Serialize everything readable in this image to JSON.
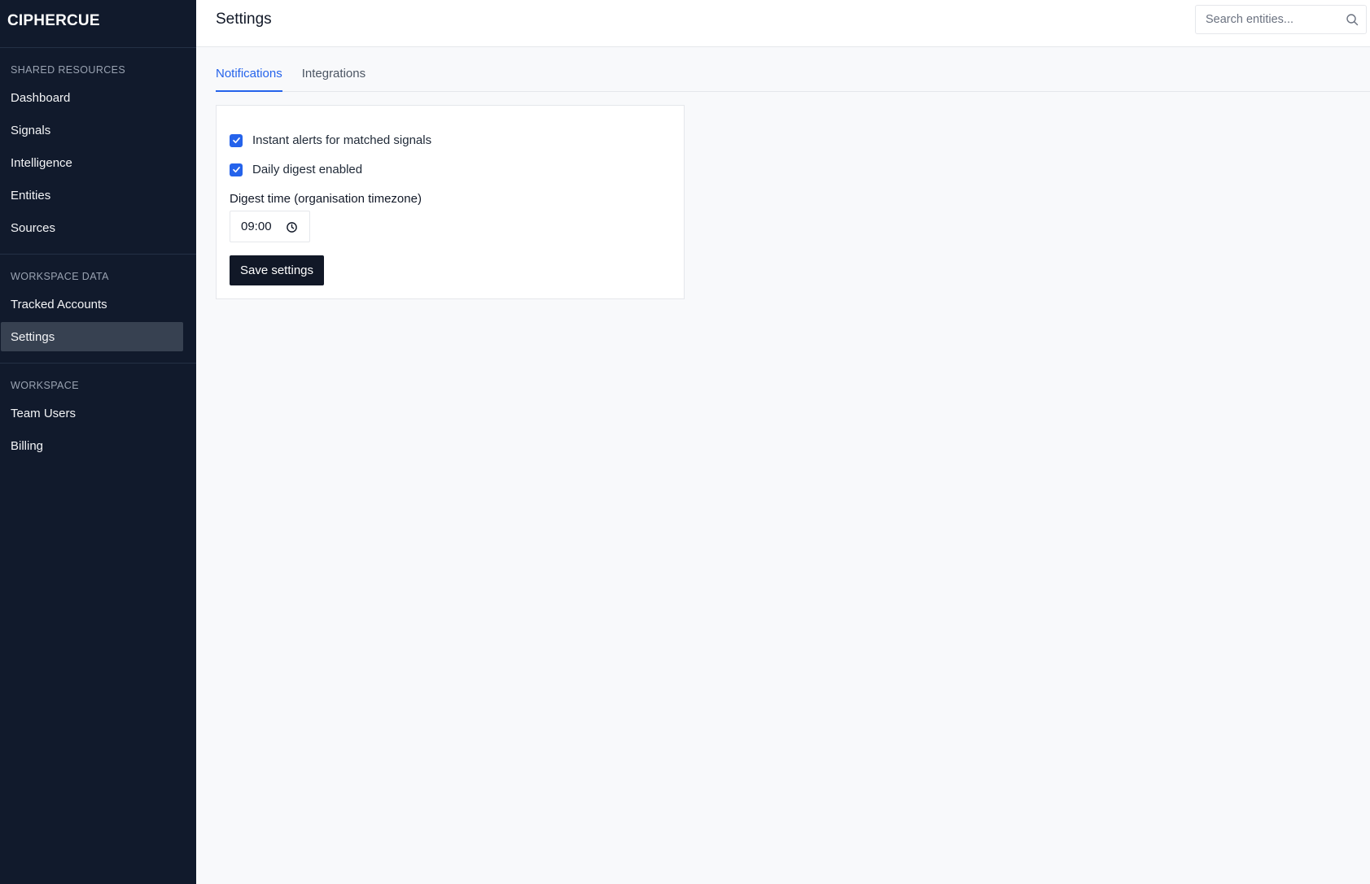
{
  "app": {
    "brand": "CIPHERCUE"
  },
  "sidebar": {
    "sections": [
      {
        "label": "SHARED RESOURCES",
        "items": [
          "Dashboard",
          "Signals",
          "Intelligence",
          "Entities",
          "Sources"
        ]
      },
      {
        "label": "WORKSPACE DATA",
        "items": [
          "Tracked Accounts",
          "Settings"
        ]
      },
      {
        "label": "WORKSPACE",
        "items": [
          "Team Users",
          "Billing"
        ]
      }
    ],
    "active_item": "Settings"
  },
  "header": {
    "title": "Settings",
    "search_placeholder": "Search entities..."
  },
  "tabs": [
    {
      "label": "Notifications",
      "active": true
    },
    {
      "label": "Integrations",
      "active": false
    }
  ],
  "notifications": {
    "instant_alerts": {
      "label": "Instant alerts for matched signals",
      "checked": true
    },
    "daily_digest": {
      "label": "Daily digest enabled",
      "checked": true
    },
    "digest_time": {
      "label": "Digest time (organisation timezone)",
      "value": "09:00"
    },
    "save_label": "Save settings"
  },
  "icons": {
    "search": "search-icon",
    "clock": "clock-icon",
    "check": "check-icon"
  },
  "colors": {
    "sidebar_bg": "#111a2c",
    "accent": "#2563eb",
    "primary_button": "#111827"
  }
}
